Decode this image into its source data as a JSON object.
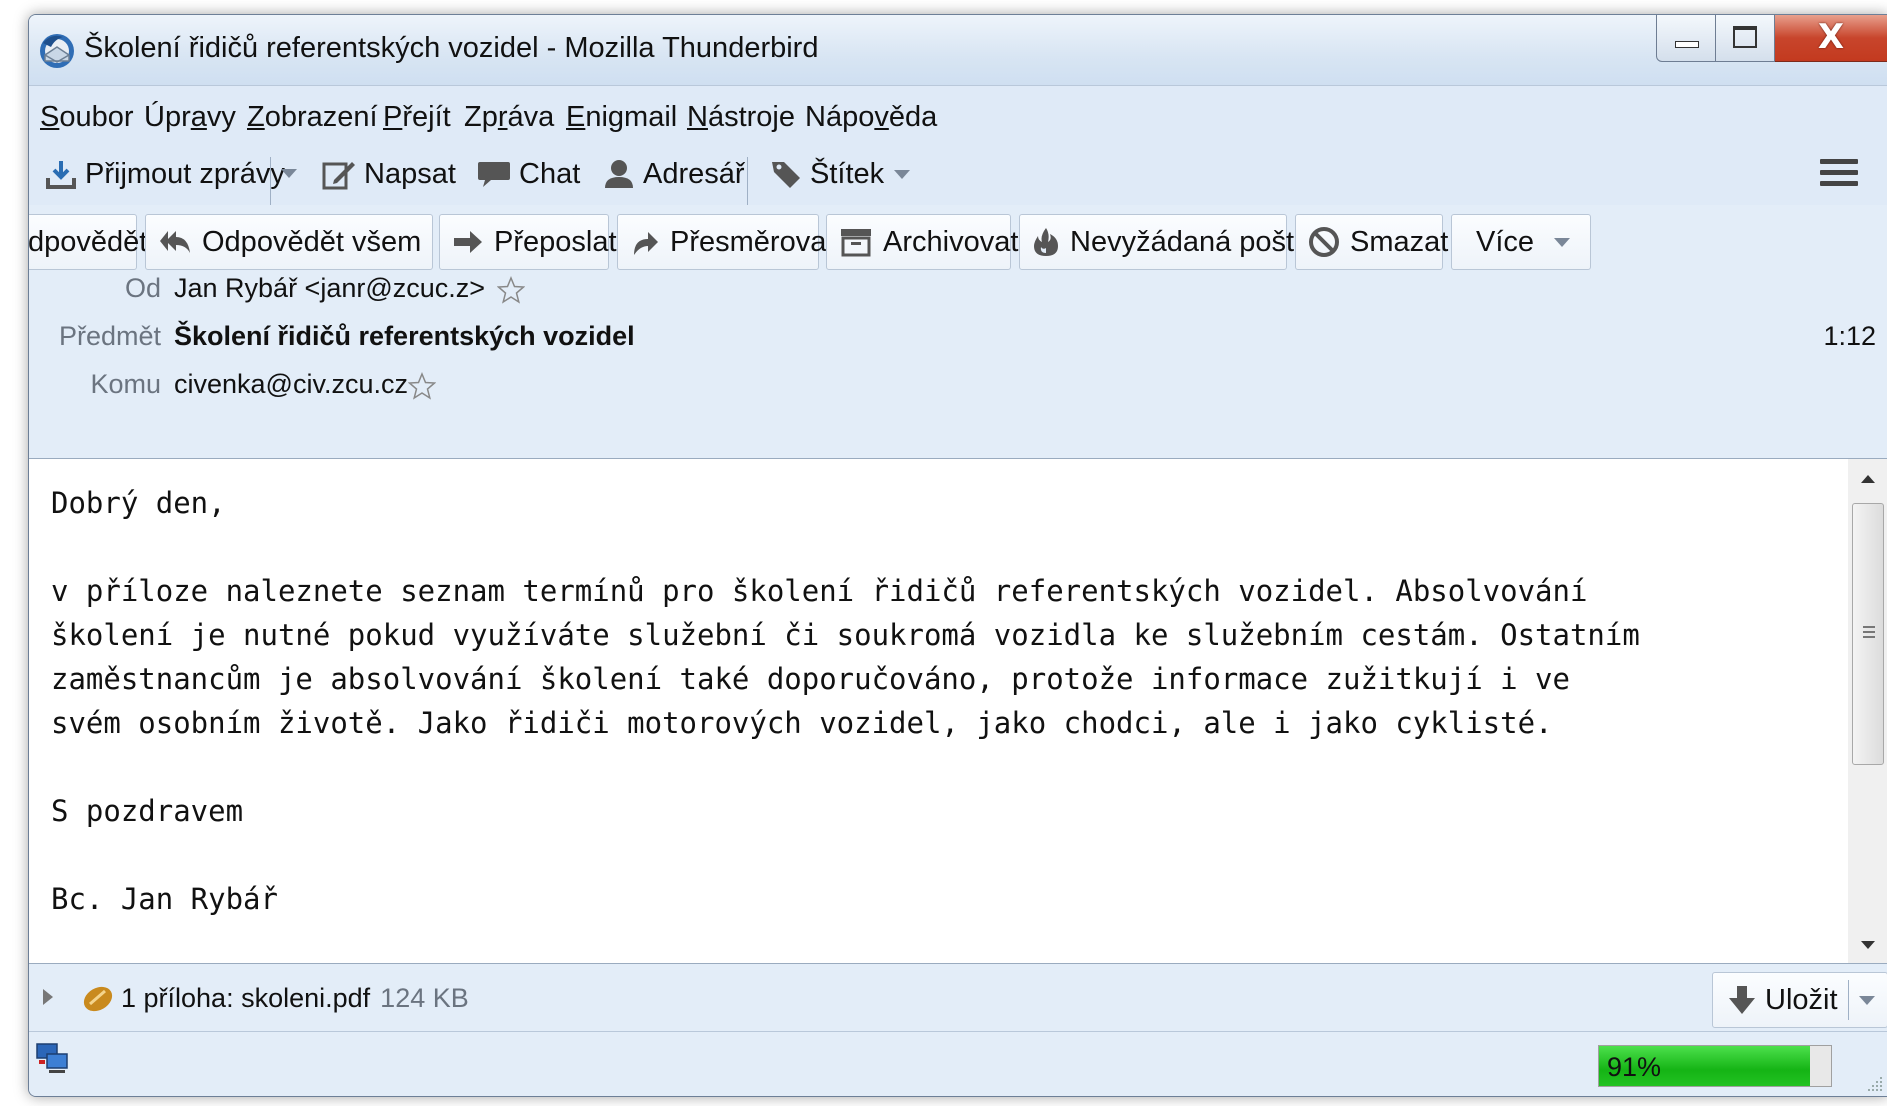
{
  "window": {
    "title": "Školení řidičů referentských vozidel - Mozilla Thunderbird"
  },
  "menu": [
    {
      "pre": "",
      "ul": "S",
      "post": "oubor"
    },
    {
      "pre": "Úpr",
      "ul": "a",
      "post": "vy"
    },
    {
      "pre": "",
      "ul": "Z",
      "post": "obrazení"
    },
    {
      "pre": "",
      "ul": "P",
      "post": "řejít"
    },
    {
      "pre": "Zp",
      "ul": "r",
      "post": "áva"
    },
    {
      "pre": "",
      "ul": "E",
      "post": "nigmail"
    },
    {
      "pre": "",
      "ul": "N",
      "post": "ástroje"
    },
    {
      "pre": "Nápo",
      "ul": "v",
      "post": "ěda"
    }
  ],
  "toolbar": {
    "get_mail": "Přijmout zprávy",
    "write": "Napsat",
    "chat": "Chat",
    "address_book": "Adresář",
    "tag": "Štítek"
  },
  "header_buttons": {
    "reply": "dpovědět",
    "reply_all": "Odpovědět všem",
    "forward": "Přeposlat",
    "redirect": "Přesměrovat",
    "archive": "Archivovat",
    "junk": "Nevyžádaná pošta",
    "delete": "Smazat",
    "more": "Více"
  },
  "message": {
    "from_label": "Od",
    "from": "Jan Rybář <janr@zcuc.z>",
    "subject_label": "Předmět",
    "subject": "Školení řidičů referentských vozidel",
    "time": "1:12",
    "to_label": "Komu",
    "to": "civenka@civ.zcu.cz",
    "body": "Dobrý den,\n\nv příloze naleznete seznam termínů pro školení řidičů referentských vozidel. Absolvování\nškolení je nutné pokud využíváte služební či soukromá vozidla ke služebním cestám. Ostatním\nzaměstnancům je absolvování školení také doporučováno, protože informace zužitkují i ve\nsvém osobním životě. Jako řidiči motorových vozidel, jako chodci, ale i jako cyklisté.\n\nS pozdravem\n\nBc. Jan Rybář"
  },
  "attachment": {
    "label": "1 příloha: skoleni.pdf",
    "size": "124 KB",
    "save": "Uložit"
  },
  "status": {
    "progress_text": "91%",
    "progress_value": 0.91
  },
  "colors": {
    "progress_fill": "#15b415",
    "close_button": "#c8452c"
  }
}
